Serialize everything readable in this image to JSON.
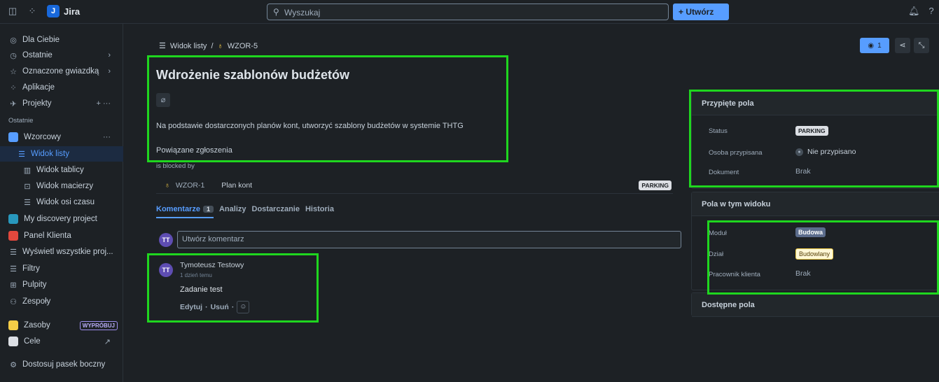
{
  "topbar": {
    "brand": "Jira",
    "search_placeholder": "Wyszukaj",
    "create_label": "+ Utwórz"
  },
  "sidebar": {
    "for_you": "Dla Ciebie",
    "recent": "Ostatnie",
    "starred": "Oznaczone gwiazdką",
    "apps": "Aplikacje",
    "projects": "Projekty",
    "recent_section": "Ostatnie",
    "project_wzorcowy": "Wzorcowy",
    "list_view": "Widok listy",
    "board_view": "Widok tablicy",
    "matrix_view": "Widok macierzy",
    "timeline_view": "Widok osi czasu",
    "discovery": "My discovery project",
    "client_panel": "Panel Klienta",
    "show_all": "Wyświetl wszystkie proj...",
    "filters": "Filtry",
    "dashboards": "Pulpity",
    "teams": "Zespoły",
    "assets": "Zasoby",
    "try_badge": "WYPRÓBUJ",
    "goals": "Cele",
    "customize": "Dostosuj pasek boczny"
  },
  "issue": {
    "crumb_view": "Widok listy",
    "crumb_sep": "/",
    "crumb_key": "WZOR-5",
    "title": "Wdrożenie szablonów budżetów",
    "description": "Na podstawie dostarczonych planów kont, utworzyć szablony budżetów w systemie THTG",
    "linked_heading": "Powiązane zgłoszenia",
    "blocked_by": "is blocked by",
    "linked_key": "WZOR-1",
    "linked_name": "Plan kont",
    "linked_status": "PARKING",
    "watch_count": "1"
  },
  "tabs": {
    "comments": "Komentarze",
    "comments_count": "1",
    "analyses": "Analizy",
    "delivery": "Dostarczanie",
    "history": "Historia"
  },
  "comment": {
    "avatar": "TT",
    "input_placeholder": "Utwórz komentarz",
    "author": "Tymoteusz Testowy",
    "time": "1 dzień temu",
    "body": "Zadanie test",
    "edit": "Edytuj",
    "dot": "·",
    "delete": "Usuń"
  },
  "pinned": {
    "heading": "Przypięte pola",
    "status_label": "Status",
    "status_value": "PARKING",
    "assignee_label": "Osoba przypisana",
    "assignee_value": "Nie przypisano",
    "document_label": "Dokument",
    "document_value": "Brak"
  },
  "view_fields": {
    "heading": "Pola w tym widoku",
    "module_label": "Moduł",
    "module_value": "Budowa",
    "dept_label": "Dział",
    "dept_value": "Budowlany",
    "worker_label": "Pracownik klienta",
    "worker_value": "Brak"
  },
  "available": {
    "heading": "Dostępne pola"
  },
  "colors": {
    "accent": "#579dff",
    "highlight": "#1fd61f",
    "background": "#1d2125"
  }
}
